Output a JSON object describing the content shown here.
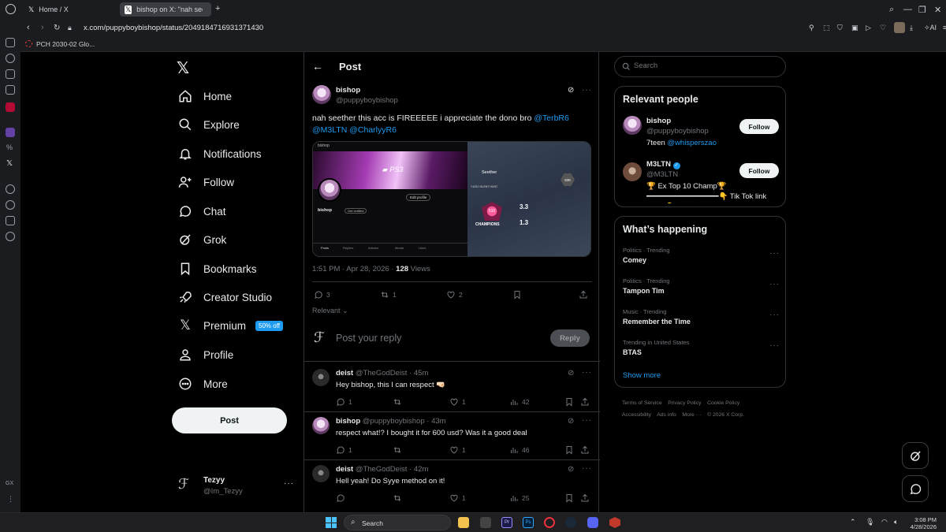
{
  "browser": {
    "tabs": [
      {
        "title": "Home / X"
      },
      {
        "title": "bishop on X: \"nah seether"
      }
    ],
    "url": "x.com/puppyboybishop/status/2049184716931371430",
    "bookmark": "PCH 2030-02 Glo...",
    "extension_label": "AI"
  },
  "nav": {
    "items": [
      {
        "label": "Home"
      },
      {
        "label": "Explore"
      },
      {
        "label": "Notifications"
      },
      {
        "label": "Follow"
      },
      {
        "label": "Chat"
      },
      {
        "label": "Grok"
      },
      {
        "label": "Bookmarks"
      },
      {
        "label": "Creator Studio"
      },
      {
        "label": "Premium"
      },
      {
        "label": "Profile"
      },
      {
        "label": "More"
      }
    ],
    "premium_badge": "50% off",
    "post_button": "Post",
    "account": {
      "name": "Tezyy",
      "handle": "@Im_Tezyy"
    }
  },
  "header": {
    "title": "Post"
  },
  "tweet": {
    "name": "bishop",
    "handle": "@puppyboybishop",
    "text": "nah seether this acc is FIREEEEE i appreciate the dono bro",
    "mentions": [
      "@TerbR6",
      "@M3LTN",
      "@CharlyyR6"
    ],
    "time": "1:51 PM · Apr 28, 2026 · ",
    "views_count": "128",
    "views_label": " Views",
    "replies": "3",
    "reposts": "1",
    "likes": "2",
    "image_left": {
      "name": "bishop",
      "edit_profile": "Edit profile",
      "get_verified": "Get verified",
      "tabs": [
        "Posts",
        "Replies",
        "Articles",
        "Media",
        "Likes"
      ]
    },
    "image_right": {
      "player": "Seether",
      "label_season": "Y11S1 SILENT HUNT",
      "rank_value": "3.3",
      "kd_value": "1.3",
      "rank_label": "CHAMPIONS",
      "badge": "836",
      "rank_number": "510"
    }
  },
  "sort_label": "Relevant",
  "reply_box": {
    "placeholder": "Post your reply",
    "button": "Reply"
  },
  "replies": [
    {
      "name": "deist",
      "handle": "@TheGodDeist",
      "time": "· 45m",
      "text": "Hey bishop, this I can respect 🤜🏻",
      "replies": "1",
      "reposts": "",
      "likes": "1",
      "views": "42"
    },
    {
      "name": "bishop",
      "handle": "@puppyboybishop",
      "time": "· 43m",
      "text": "respect what!? I bought it for 600 usd? Was it a good deal",
      "replies": "1",
      "reposts": "",
      "likes": "1",
      "views": "46"
    },
    {
      "name": "deist",
      "handle": "@TheGodDeist",
      "time": "· 42m",
      "text": "Hell yeah! Do Syye method on it!",
      "replies": "",
      "reposts": "",
      "likes": "1",
      "views": "25"
    }
  ],
  "search": {
    "placeholder": "Search"
  },
  "relevant_people": {
    "title": "Relevant people",
    "people": [
      {
        "name": "bishop",
        "handle": "@puppyboybishop",
        "bio": "7teen ",
        "bio_link": "@whisperszao",
        "follow": "Follow"
      },
      {
        "name": "M3LTN",
        "handle": "@M3LTN",
        "bio": "🏆 Ex Top 10 Champ🏆━━━━━━━━━━━━━━━━👇 Tik Tok link below👇",
        "bio_link": "",
        "follow": "Follow"
      }
    ]
  },
  "trends": {
    "title": "What’s happening",
    "items": [
      {
        "category": "Politics · Trending",
        "name": "Comey"
      },
      {
        "category": "Politics · Trending",
        "name": "Tampon Tim"
      },
      {
        "category": "Music · Trending",
        "name": "Remember the Time"
      },
      {
        "category": "Trending in United States",
        "name": "BTAS"
      }
    ],
    "show_more": "Show more"
  },
  "footer": {
    "links": [
      "Terms of Service",
      "Privacy Policy",
      "Cookie Policy",
      "Accessibility",
      "Ads info",
      "More ···",
      "© 2026 X Corp."
    ]
  },
  "taskbar": {
    "search": "Search",
    "time": "3:08 PM",
    "date": "4/28/2026"
  },
  "colors": {
    "accent": "#1d9bf0",
    "bg": "#000000",
    "border": "#2f3336"
  }
}
